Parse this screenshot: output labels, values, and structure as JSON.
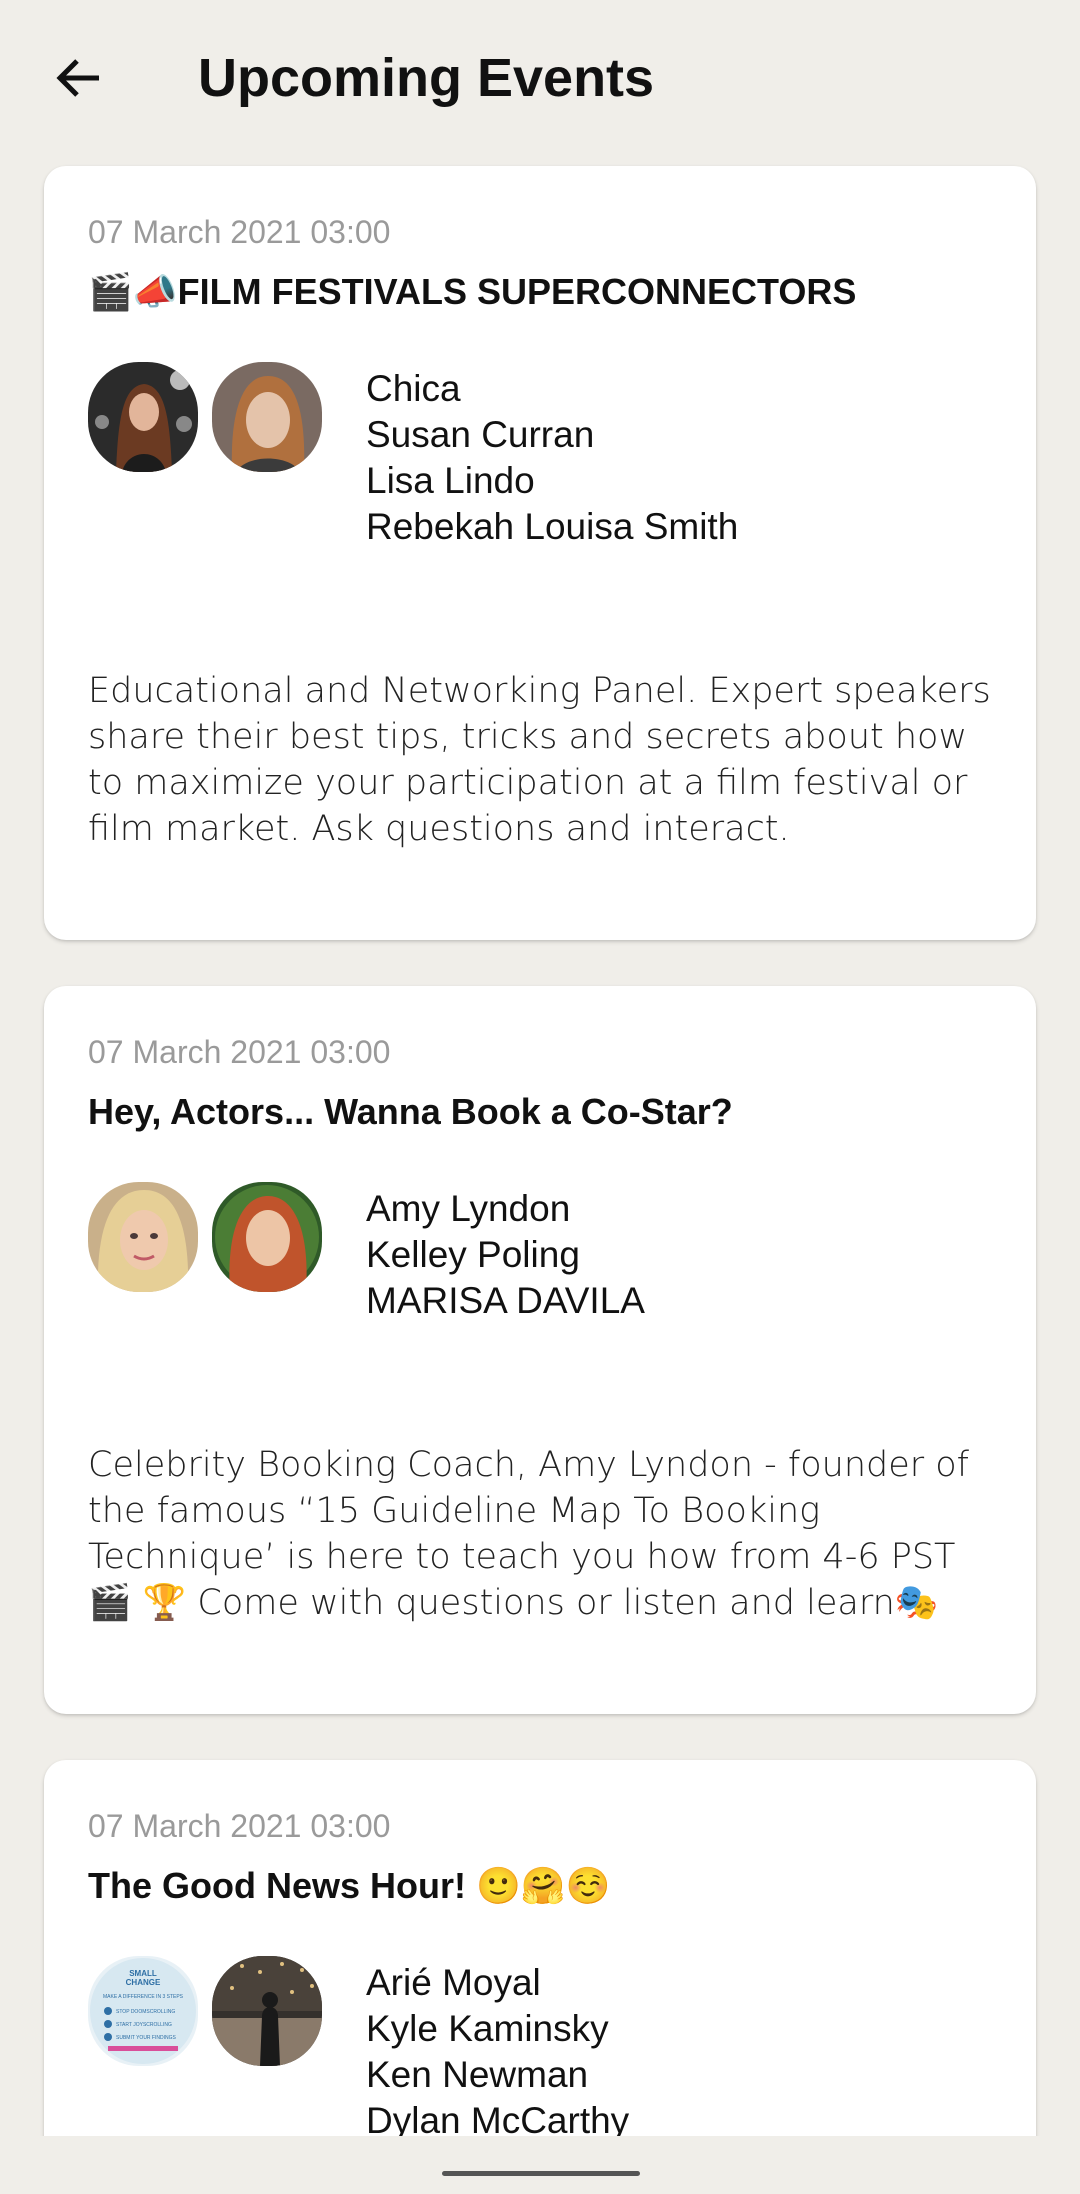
{
  "header": {
    "title": "Upcoming Events"
  },
  "events": [
    {
      "date": "07 March 2021 03:00",
      "title_text": "FILM FESTIVALS SUPERCONNECTORS",
      "title_prefix_emoji": "🎬📣",
      "hosts": [
        "Chica",
        "Susan Curran",
        "Lisa Lindo",
        "Rebekah Louisa Smith"
      ],
      "description": "Educational and Networking Panel. Expert speakers share their best tips, tricks and secrets about how to maximize your participation at a film festival or film market. Ask questions and interact."
    },
    {
      "date": "07 March 2021 03:00",
      "title_text": "Hey, Actors... Wanna Book a Co-Star?",
      "hosts": [
        "Amy Lyndon",
        "Kelley Poling",
        "MARISA DAVILA"
      ],
      "description": "Celebrity Booking Coach, Amy Lyndon - founder of the famous “15 Guideline Map To Booking Technique’ is here to teach you how from 4-6 PST 🎬 🏆 Come with questions or listen and learn🎭"
    },
    {
      "date": "07 March 2021 03:00",
      "title_text": "The Good News Hour!",
      "title_suffix_emoji": "🙂🤗☺️",
      "hosts": [
        "Arié Moyal",
        "Kyle Kaminsky",
        "Ken Newman",
        "Dylan McCarthy"
      ],
      "avatar1_lines": [
        "SMALL",
        "CHANGE",
        "MAKE A DIFFERENCE IN 3 STEPS",
        "STOP DOOMSCROLLING",
        "START JOYSCROLLING",
        "SUBMIT YOUR FINDINGS"
      ]
    }
  ],
  "colors": {
    "background": "#f0eee9",
    "card": "#ffffff",
    "date_text": "#9a9a9a"
  }
}
